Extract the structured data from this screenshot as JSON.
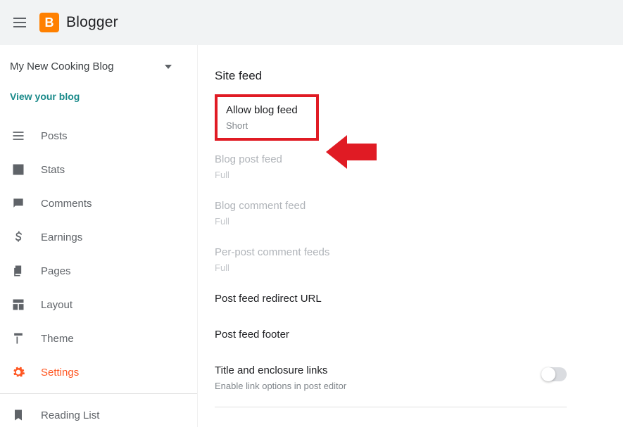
{
  "brand": "Blogger",
  "blogName": "My New Cooking Blog",
  "viewBlog": "View your blog",
  "nav": {
    "posts": "Posts",
    "stats": "Stats",
    "comments": "Comments",
    "earnings": "Earnings",
    "pages": "Pages",
    "layout": "Layout",
    "theme": "Theme",
    "settings": "Settings",
    "readingList": "Reading List"
  },
  "section": {
    "title": "Site feed",
    "allowFeed": {
      "title": "Allow blog feed",
      "value": "Short"
    },
    "blogPostFeed": {
      "title": "Blog post feed",
      "value": "Full"
    },
    "blogCommentFeed": {
      "title": "Blog comment feed",
      "value": "Full"
    },
    "perPostCommentFeeds": {
      "title": "Per-post comment feeds",
      "value": "Full"
    },
    "redirectUrl": {
      "title": "Post feed redirect URL"
    },
    "footer": {
      "title": "Post feed footer"
    },
    "enclosure": {
      "title": "Title and enclosure links",
      "sub": "Enable link options in post editor"
    }
  }
}
